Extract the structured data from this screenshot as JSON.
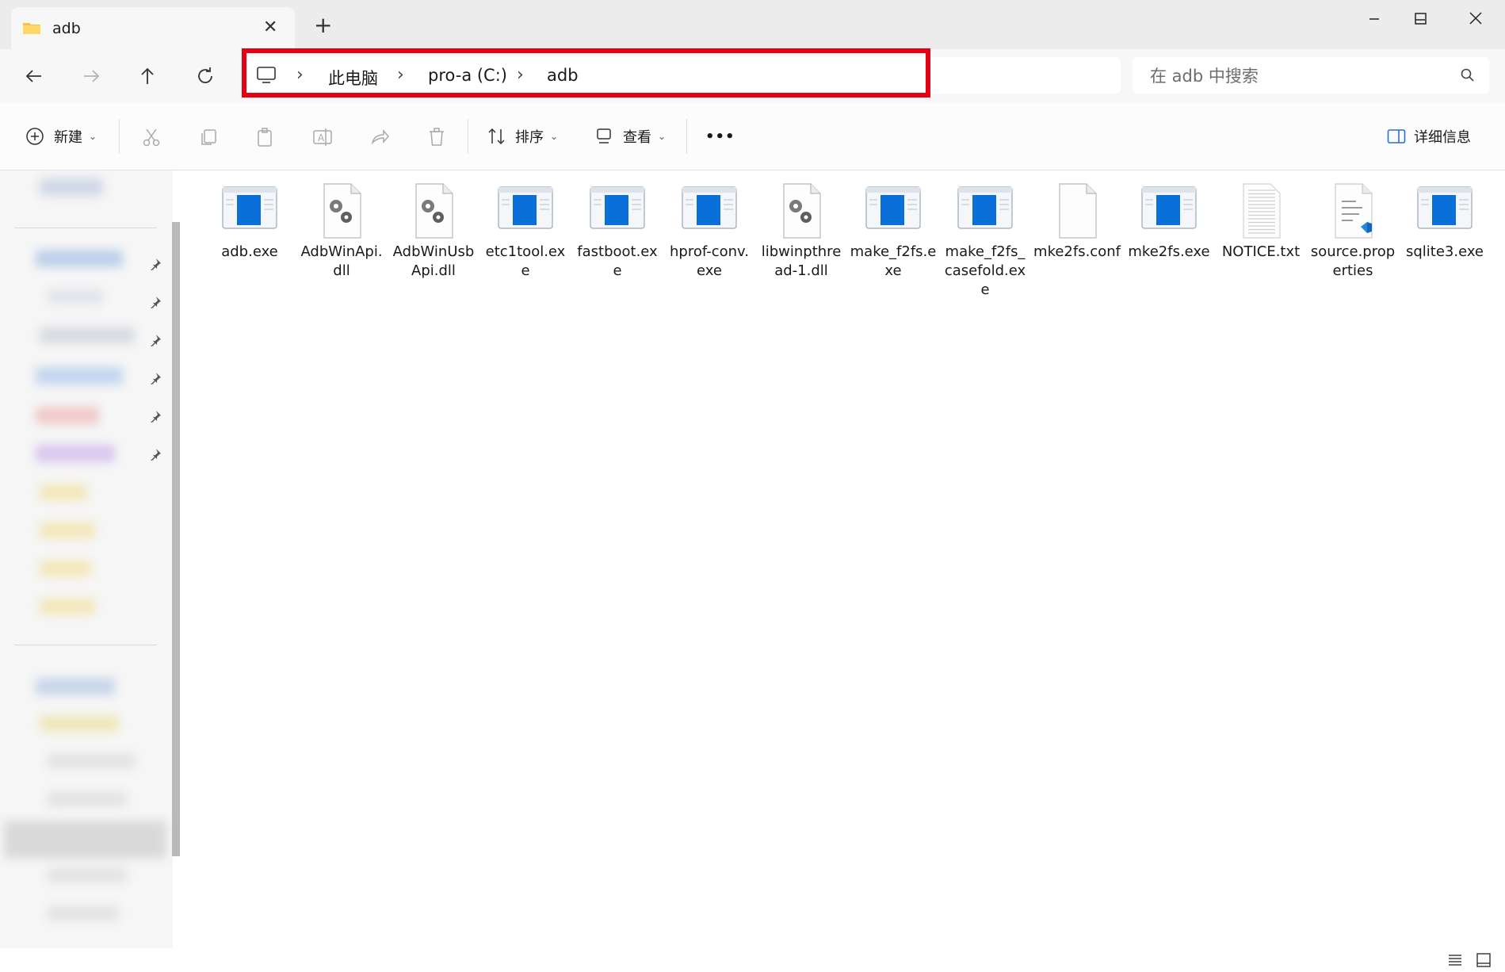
{
  "window": {
    "tab_title": "adb",
    "tab_close": "✕",
    "new_tab": "+"
  },
  "nav": {
    "breadcrumb": [
      "此电脑",
      "pro-a (C:)",
      "adb"
    ],
    "separator": "›",
    "search_placeholder": "在 adb 中搜索"
  },
  "toolbar": {
    "new_label": "新建",
    "sort_label": "排序",
    "view_label": "查看",
    "more_label": "•••",
    "details_label": "详细信息"
  },
  "files": [
    {
      "name": "adb.exe",
      "type": "exe"
    },
    {
      "name": "AdbWinApi.dll",
      "type": "dll"
    },
    {
      "name": "AdbWinUsbApi.dll",
      "type": "dll"
    },
    {
      "name": "etc1tool.exe",
      "type": "exe"
    },
    {
      "name": "fastboot.exe",
      "type": "exe"
    },
    {
      "name": "hprof-conv.exe",
      "type": "exe"
    },
    {
      "name": "libwinpthread-1.dll",
      "type": "dll"
    },
    {
      "name": "make_f2fs.exe",
      "type": "exe"
    },
    {
      "name": "make_f2fs_casefold.exe",
      "type": "exe"
    },
    {
      "name": "mke2fs.conf",
      "type": "blank"
    },
    {
      "name": "mke2fs.exe",
      "type": "exe"
    },
    {
      "name": "NOTICE.txt",
      "type": "txt"
    },
    {
      "name": "source.properties",
      "type": "props"
    },
    {
      "name": "sqlite3.exe",
      "type": "exe"
    }
  ],
  "colors": {
    "highlight": "#e60012",
    "exe_blue": "#0a6fd8",
    "folder_yellow": "#f4c542"
  }
}
